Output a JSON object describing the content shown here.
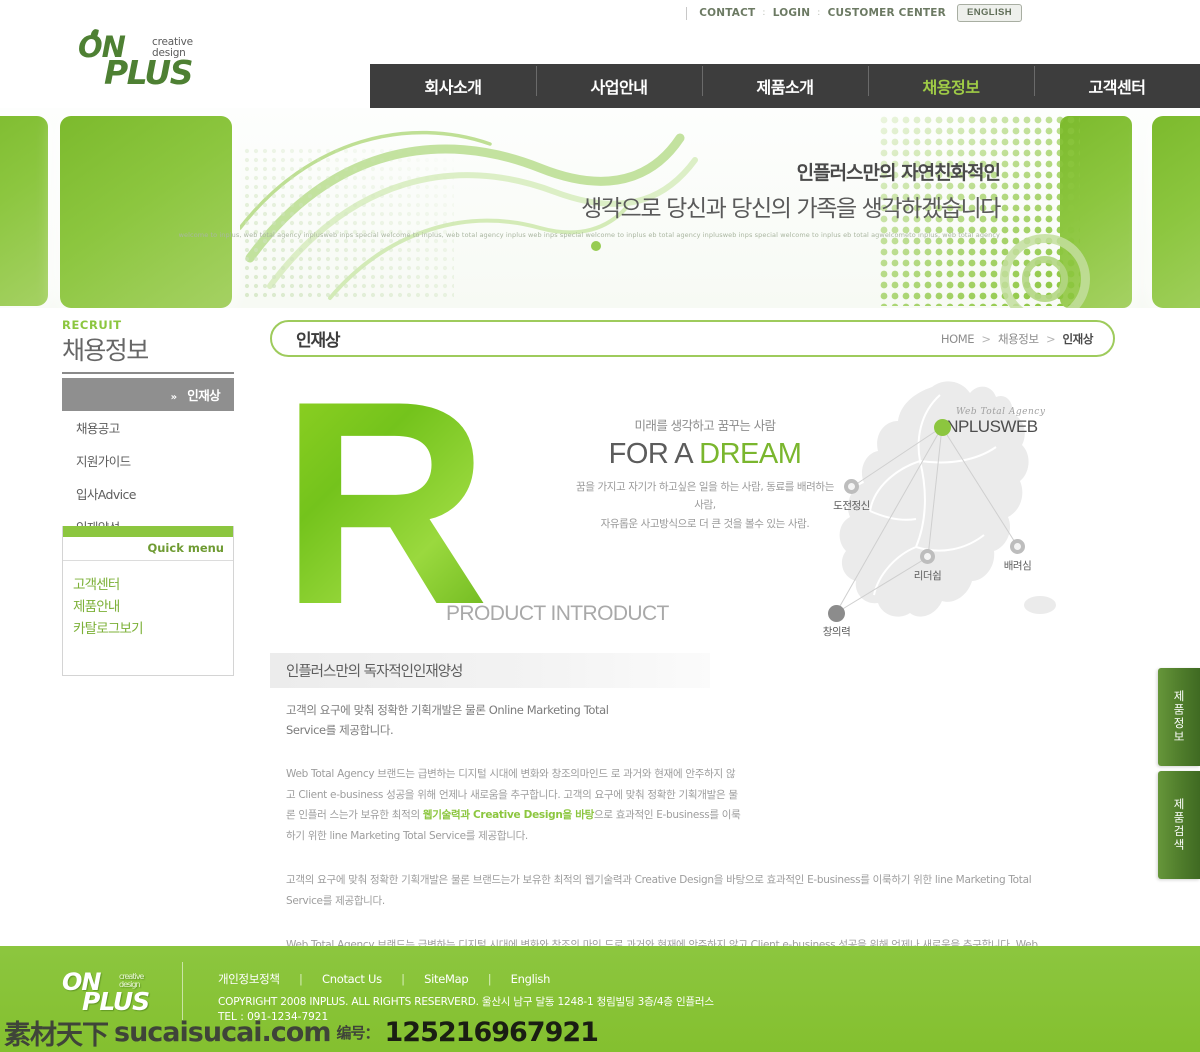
{
  "utility": {
    "links": [
      "CONTACT",
      "LOGIN",
      "CUSTOMER CENTER"
    ],
    "separator": ":",
    "language_button": "ENGLISH"
  },
  "logo": {
    "prefix": "ON",
    "suffix": "PLUS",
    "tagline": "creative design"
  },
  "nav": {
    "items": [
      {
        "label": "회사소개",
        "active": false
      },
      {
        "label": "사업안내",
        "active": false
      },
      {
        "label": "제품소개",
        "active": false
      },
      {
        "label": "채용정보",
        "active": true
      },
      {
        "label": "고객센터",
        "active": false
      }
    ],
    "subitems": [
      {
        "label": "인재상",
        "active": true
      },
      {
        "label": "채용공고",
        "active": false
      },
      {
        "label": "지원가이드",
        "active": false
      },
      {
        "label": "입사Advice",
        "active": false
      },
      {
        "label": "인재양성",
        "active": false
      }
    ]
  },
  "banner": {
    "line1": "인플러스만의 자연친화적인",
    "line2": "생각으로 당신과 당신의 가족을 생각하겠습니다",
    "small": "welcome to inplus, web total agency inplusweb inps special welcome to inplus, web total agency inplus web inps special welcome to  inplus eb total agency inplusweb inps special welcome to  inplus  eb total  agwelcometo inplus, web total agency"
  },
  "sidebar": {
    "eng_title": "RECRUIT",
    "kor_title": "채용정보",
    "items": [
      {
        "label": "인재상",
        "active": true
      },
      {
        "label": "채용공고",
        "active": false
      },
      {
        "label": "지원가이드",
        "active": false
      },
      {
        "label": "입사Advice",
        "active": false
      },
      {
        "label": "인재양성",
        "active": false
      }
    ],
    "quick": {
      "title": "Quick menu",
      "items": [
        "고객센터",
        "제품안내",
        "카탈로그보기"
      ]
    }
  },
  "page": {
    "title": "인재상",
    "breadcrumb": {
      "home": "HOME",
      "parent": "채용정보",
      "current": "인재상"
    }
  },
  "hero": {
    "big_letter": "R",
    "product_introduct": "PRODUCT INTRODUCT",
    "dream_top": "미래를 생각하고 꿈꾸는 사람",
    "dream_main_1": "FOR A ",
    "dream_main_2": "DREAM",
    "dream_desc_1": "꿈을 가지고 자기가 하고싶은 일을 하는 사람, 동료를 배려하는 사람,",
    "dream_desc_2": "자유롭운 사고방식으로 더 큰 것을 볼수 있는 사람."
  },
  "map": {
    "cursive": "Web Total Agency",
    "brand": "INPLUSWEB",
    "nodes": [
      {
        "label": "도전정신",
        "type": "ring"
      },
      {
        "label": "창의력",
        "type": "solid-gray"
      },
      {
        "label": "리더쉽",
        "type": "ring"
      },
      {
        "label": "배려심",
        "type": "ring"
      }
    ]
  },
  "section": {
    "heading": "인플러스만의 독자적인인재양성",
    "lead_1": "고객의 요구에 맞춰 정확한 기획개발은 물론 Online Marketing Total",
    "lead_2": "Service를 제공합니다.",
    "para1_a": "Web Total Agency 브랜드는 급변하는 디지털 시대에 변화와 창조의마인드 로 과거와 현재에 안주하지 않고 Client e-business 성공을 위해 언제나 새로움을 추구합니다. 고객의 요구에 맞춰 정확한 기획개발은 물론 인플러 스는가 보유한 최적의 ",
    "para1_hl": "웹기술력과 Creative Design을 바탕",
    "para1_b": "으로 효과적인 E-business를 이룩하기 위한 line Marketing Total Service를 제공합니다.",
    "para2": "고객의 요구에 맞춰 정확한 기획개발은 물론 브랜드는가 보유한 최적의 웹기술력과 Creative Design을 바탕으로 효과적인 E-business를 이룩하기 위한 line Marketing Total Service를 제공합니다.",
    "para3": "Web Total Agency 브랜드는 급변하는 디지털 시대에 변화와 창조의 마인 드로 과거와 현재에 안주하지 않고 Client e-business 성공을 위해 언제나 새로움을 추구합니다. Web Total Agency 브랜드는 급변하는 디지털 시대 에 변화와 창조의 마인드로 과거와 현재에 안주하지 않고 Client e-business 성공을 위해 언제나 새로움을 추구합니다."
  },
  "right_tabs": [
    {
      "label": "제품정보"
    },
    {
      "label": "제품검색"
    }
  ],
  "footer": {
    "links": [
      "개인정보정책",
      "Cnotact Us",
      "SiteMap",
      "English"
    ],
    "copyright": "COPYRIGHT 2008 INPLUS. ALL RIGHTS RESERVERD. 울산시 남구 달동 1248-1 청림빌딩 3층/4층 인플러스",
    "tel": "TEL : 091-1234-7921"
  },
  "watermark": {
    "cn": "素材天下",
    "site": "sucaisucai.com",
    "label": "编号：",
    "number": "125216967921"
  },
  "colors": {
    "brand_green": "#8cc63f",
    "dark_green": "#4e8033",
    "nav_dark": "#3d3d3d",
    "text_gray": "#7b7b7b"
  }
}
